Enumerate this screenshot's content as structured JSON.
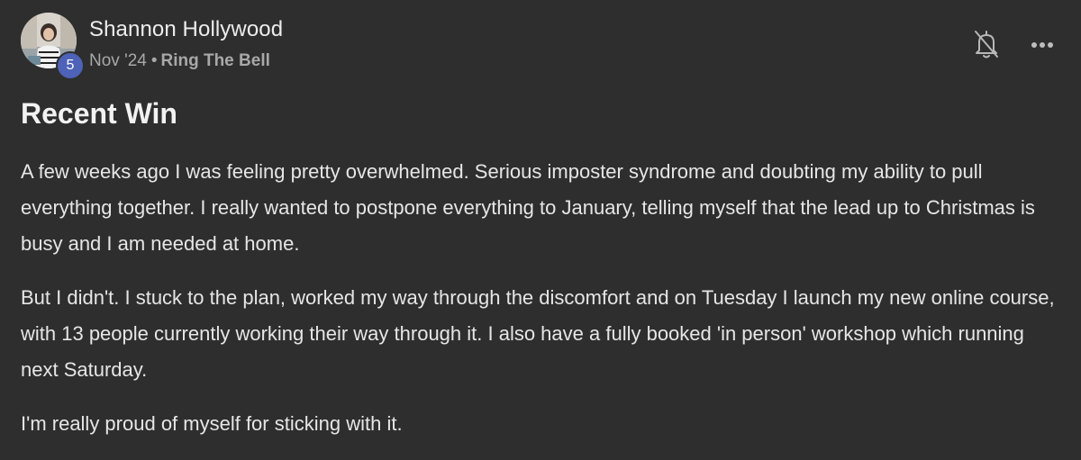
{
  "author": {
    "name": "Shannon Hollywood",
    "level": "5"
  },
  "meta": {
    "date": "Nov '24",
    "separator": "•",
    "category": "Ring The Bell"
  },
  "post": {
    "title": "Recent Win",
    "paragraphs": [
      "A few weeks ago I was feeling pretty overwhelmed. Serious imposter syndrome and doubting my ability to pull everything together. I really wanted to postpone everything to January, telling myself that the lead up to Christmas is busy and I am needed at home.",
      "But I didn't. I stuck to the plan, worked my way through the discomfort and on Tuesday I launch my new online course, with 13 people currently working their way through it. I also have a fully booked 'in person' workshop which running next Saturday.",
      "I'm really proud of myself for sticking with it."
    ]
  },
  "icons": {
    "bell": "bell-off-icon",
    "more": "more-horizontal-icon",
    "avatar": "avatar-photo"
  },
  "colors": {
    "background": "#2e2e2e",
    "badge": "#4e62b8",
    "text": "#e6e6e6",
    "muted": "#a8a8a8"
  }
}
